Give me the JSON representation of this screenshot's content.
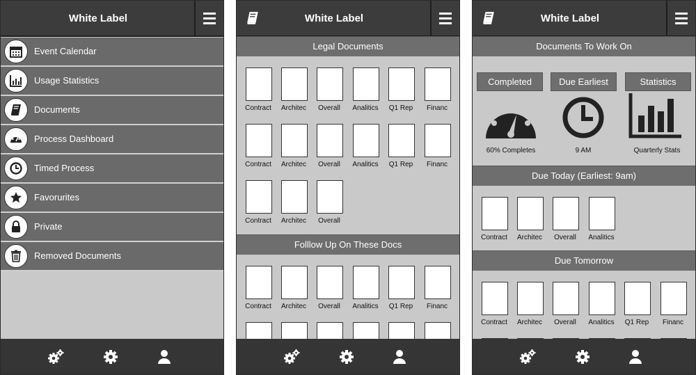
{
  "app_title": "White Label",
  "sidebar": {
    "items": [
      {
        "label": "Event Calendar",
        "icon": "calendar-icon"
      },
      {
        "label": "Usage Statistics",
        "icon": "bar-chart-icon"
      },
      {
        "label": "Documents",
        "icon": "book-icon"
      },
      {
        "label": "Process Dashboard",
        "icon": "dashboard-icon"
      },
      {
        "label": "Timed Process",
        "icon": "clock-icon"
      },
      {
        "label": "Favorurites",
        "icon": "star-icon"
      },
      {
        "label": "Private",
        "icon": "lock-icon"
      },
      {
        "label": "Removed Documents",
        "icon": "trash-icon"
      }
    ]
  },
  "documents_screen": {
    "section1": "Legal Documents",
    "section2": "Folllow Up On These Docs",
    "docs_row": [
      "Contract",
      "Architec",
      "Overall",
      "Analitics",
      "Q1 Rep",
      "Financ"
    ],
    "docs_short": [
      "Contract",
      "Architec",
      "Overall"
    ]
  },
  "work_screen": {
    "header": "Documents To Work On",
    "stats": [
      {
        "button": "Completed",
        "caption": "60% Completes",
        "icon": "gauge-icon"
      },
      {
        "button": "Due Earliest",
        "caption": "9 AM",
        "icon": "clock-icon"
      },
      {
        "button": "Statistics",
        "caption": "Quarterly Stats",
        "icon": "bar-chart-icon"
      }
    ],
    "due_today": "Due Today (Earliest: 9am)",
    "due_today_docs": [
      "Contract",
      "Architec",
      "Overall",
      "Analitics"
    ],
    "due_tomorrow": "Due Tomorrow",
    "due_tomorrow_docs": [
      "Contract",
      "Architec",
      "Overall",
      "Analitics",
      "Q1 Rep",
      "Financ"
    ]
  },
  "bottom_icons": [
    "cogs-icon",
    "gear-icon",
    "user-icon"
  ]
}
